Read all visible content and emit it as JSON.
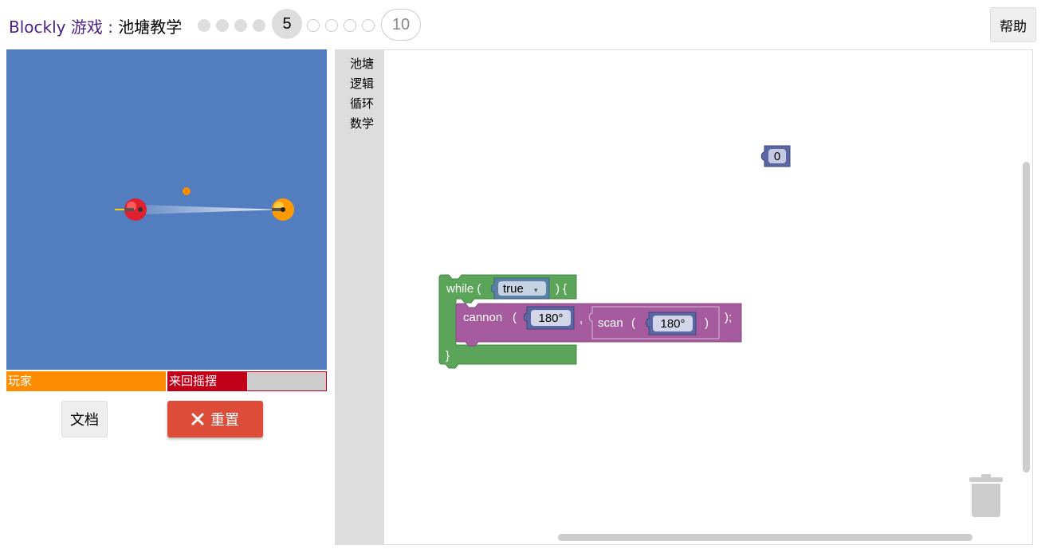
{
  "header": {
    "app_name": "Blockly 游戏",
    "separator": " : ",
    "level_name": "池塘教学",
    "current_level": "5",
    "last_level": "10",
    "help_label": "帮助"
  },
  "game": {
    "player_label": "玩家",
    "enemy_label": "来回摇摆",
    "enemy_health": 0.5,
    "docs_label": "文档",
    "reset_label": "重置"
  },
  "toolbox": {
    "categories": [
      "池塘",
      "逻辑",
      "循环",
      "数学"
    ]
  },
  "blocks": {
    "number_value": "0",
    "while_keyword": "while (",
    "while_close": ") {",
    "while_end": "}",
    "bool_value": "true",
    "cannon_label": "cannon",
    "paren_open": "(",
    "comma": ",",
    "scan_label": "scan",
    "paren_close": ")",
    "statement_end": ");",
    "cannon_angle": "180°",
    "scan_angle": "180°"
  },
  "colors": {
    "pond": "#527dbf",
    "player": "#ff8b00",
    "enemy": "#c00018",
    "loop_block": "#5ba55b",
    "pond_block": "#a55b9e",
    "math_block": "#5b67a5",
    "reset": "#dd4b39"
  }
}
